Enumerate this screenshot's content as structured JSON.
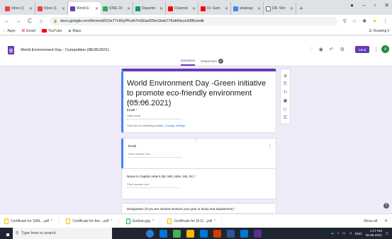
{
  "browser": {
    "tabs": [
      {
        "title": "Inbox (1",
        "fav": "#ea4335"
      },
      {
        "title": "Inbox (1",
        "fav": "#ea4335"
      },
      {
        "title": "World E",
        "fav": "#673ab7",
        "active": true
      },
      {
        "title": "KINE 20",
        "fav": "#34a853"
      },
      {
        "title": "Departm",
        "fav": "#0f9d58"
      },
      {
        "title": "Channel",
        "fav": "#ff0000"
      },
      {
        "title": "Dr. Gam",
        "fav": "#ff0000"
      },
      {
        "title": "whatsap",
        "fav": "#4285f4"
      },
      {
        "title": "DR. Win",
        "fav": "#ffffff"
      }
    ],
    "new_tab": "+",
    "window_controls": {
      "minimize": "–",
      "maximize": "▫",
      "close": "✕"
    },
    "url": "docs.google.com/forms/d/1Oe77c6hyPKvA7m9Zaof25m1bsb776otkNxunS8Rs/edit",
    "bookmarks": [
      {
        "label": "Apps",
        "icon": "apps-grid-icon"
      },
      {
        "label": "Gmail",
        "icon": "gmail-icon"
      },
      {
        "label": "YouTube",
        "icon": "youtube-icon"
      },
      {
        "label": "Maps",
        "icon": "maps-icon"
      }
    ],
    "reading_list": "Reading li"
  },
  "forms_header": {
    "doc_title": "World Environment Day - Competition (05.06.2021)",
    "tabs": {
      "questions": "Questions",
      "responses": "Responses",
      "responses_count": "9"
    },
    "send_label": "Send",
    "avatar_letter": "A",
    "accent_color": "#673ab7"
  },
  "form": {
    "title": "World Environment Day -Green initiative to promote eco-friendly environment (05.06.2021)",
    "description_placeholder": "Form description",
    "email_label": "Email",
    "email_required": "*",
    "email_placeholder": "Valid email",
    "collect_note": "This form is collecting emails.",
    "collect_link": "Change settings",
    "questions": [
      {
        "label": "Email",
        "placeholder": "Short answer text",
        "selected": true
      },
      {
        "label": "Name in Capital Letters (Mr. Mrs, Miss, Ms, Dr.)",
        "required": "*",
        "placeholder": "Short answer text"
      },
      {
        "label": "Designation (If you are student mention your year of study and department)",
        "required": "*",
        "placeholder": ""
      }
    ]
  },
  "downloads": {
    "items": [
      {
        "name": "Certificate for SAN....pdf",
        "type": "pdf"
      },
      {
        "name": "Certificate for Ant....pdf",
        "type": "pdf"
      },
      {
        "name": "Godson.jpg",
        "type": "img"
      },
      {
        "name": "Certificate for Dr.D....pdf",
        "type": "pdf"
      }
    ],
    "show_all": "Show all"
  },
  "taskbar": {
    "search_placeholder": "Type here to search",
    "language": "ENG",
    "time": "1:17 PM",
    "date": "05-06-2021"
  }
}
